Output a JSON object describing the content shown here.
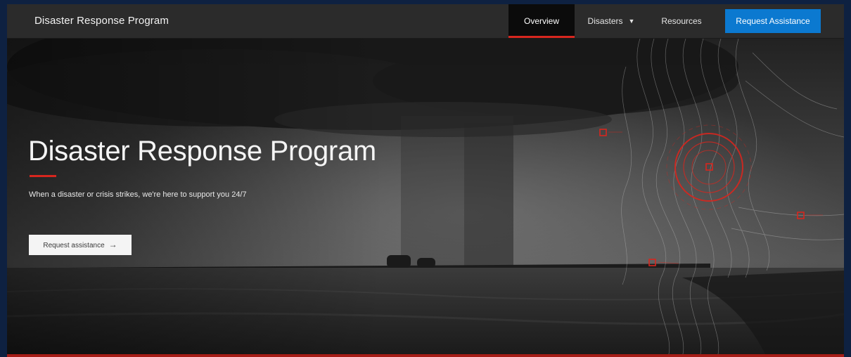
{
  "header": {
    "brand": "Disaster Response Program"
  },
  "nav": {
    "overview": "Overview",
    "disasters": "Disasters",
    "resources": "Resources",
    "request": "Request Assistance"
  },
  "icons": {
    "disasters_caret": "chevron-down-icon",
    "button_arrow": "arrow-right-icon"
  },
  "hero": {
    "title": "Disaster Response Program",
    "subtitle": "When a disaster or crisis strikes, we're here to support you 24/7",
    "button_label": "Request assistance",
    "button_arrow": "→"
  },
  "colors": {
    "accent_red": "#d7261e",
    "primary_blue": "#0b79d0",
    "nav_background": "#2b2b2b",
    "page_background": "#0e2141"
  }
}
